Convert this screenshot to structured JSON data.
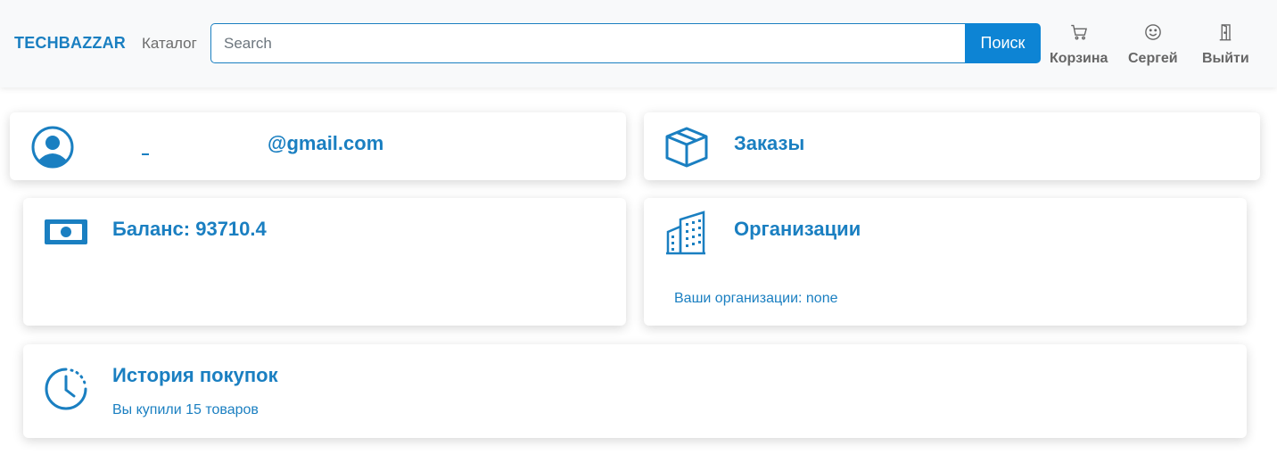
{
  "navbar": {
    "brand": "TECHBAZZAR",
    "catalog": "Каталог",
    "search": {
      "placeholder": "Search",
      "value": ""
    },
    "search_button": "Поиск",
    "cart_label": "Корзина",
    "user_label": "Сергей",
    "logout_label": "Выйти",
    "icons": {
      "cart": "cart-icon",
      "user": "smiley-icon",
      "logout": "door-icon"
    }
  },
  "profile": {
    "email": "@gmail.com",
    "icon": "user-circle-icon"
  },
  "orders": {
    "title": "Заказы",
    "icon": "box-icon"
  },
  "balance": {
    "title": "Баланс: 93710.4",
    "icon": "banknote-icon"
  },
  "organizations": {
    "title": "Организации",
    "subtitle": "Ваши организации: none",
    "icon": "buildings-icon"
  },
  "history": {
    "title": "История покупок",
    "subtitle": "Вы купили 15 товаров",
    "icon": "clock-history-icon"
  },
  "colors": {
    "accent": "#1a7fc1",
    "button": "#0d84d4",
    "navbar_bg": "#f8f9fa"
  }
}
